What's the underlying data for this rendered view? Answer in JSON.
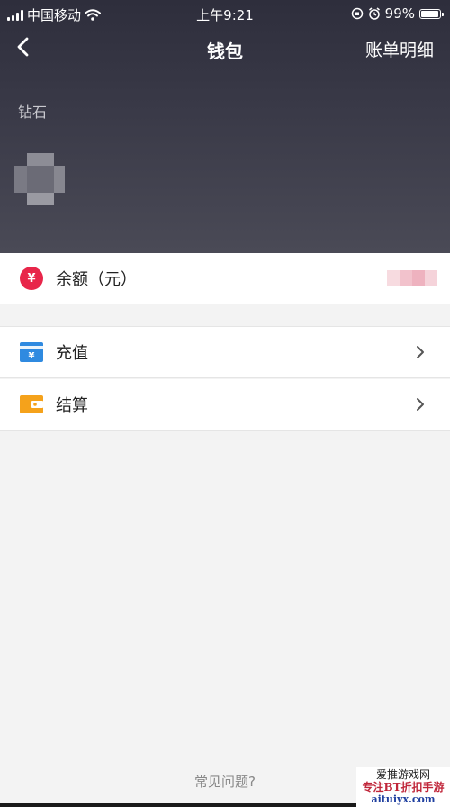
{
  "status_bar": {
    "carrier": "中国移动",
    "time": "上午9:21",
    "battery_percent": "99%",
    "battery_level": 0.99
  },
  "nav": {
    "back_icon": "chevron-left-icon",
    "title": "钱包",
    "bill_detail": "账单明细"
  },
  "diamond": {
    "label": "钻石"
  },
  "balance": {
    "icon_glyph": "¥",
    "label": "余额（元）"
  },
  "menu": [
    {
      "label": "充值",
      "icon": "recharge-card-icon",
      "icon_glyph": "¥",
      "icon_color": "#2f8ae0"
    },
    {
      "label": "结算",
      "icon": "wallet-icon",
      "icon_color": "#f5a21b"
    }
  ],
  "footer": {
    "faq": "常见问题?"
  },
  "watermark": {
    "line1": "爱推游戏网",
    "line2": "专注BT折扣手游",
    "line3": "aituiyx.com"
  },
  "colors": {
    "header_top": "#2e2e3c",
    "header_bottom": "#4a4a56",
    "balance_icon": "#e8264a",
    "background": "#f3f3f3"
  }
}
